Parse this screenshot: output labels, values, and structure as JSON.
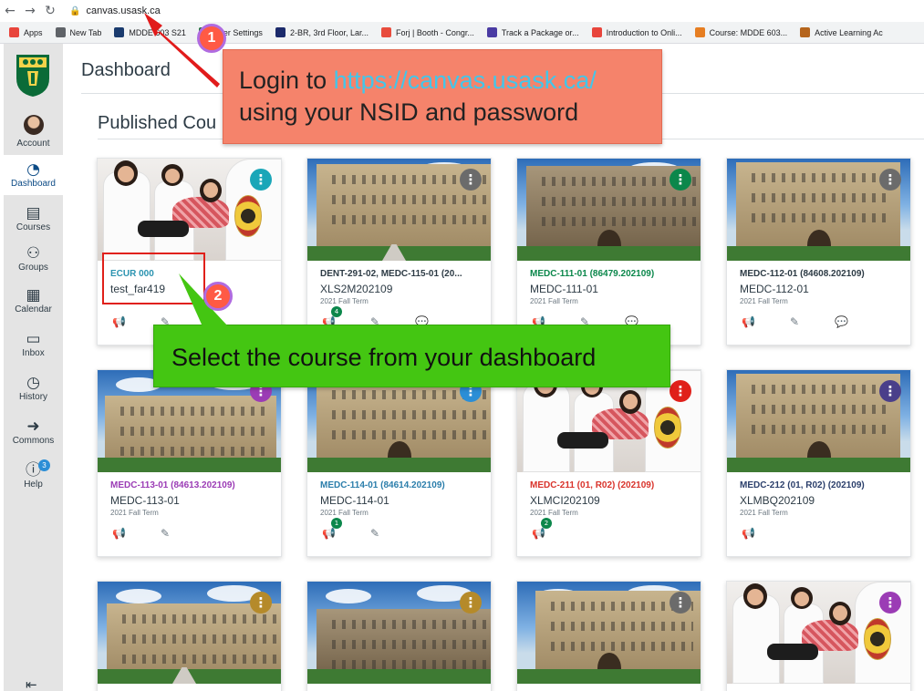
{
  "browser": {
    "url": "canvas.usask.ca",
    "bookmarks": [
      {
        "label": "Apps",
        "color": "#e8453c"
      },
      {
        "label": "New Tab",
        "color": "#5f6368"
      },
      {
        "label": "MDDE 603 S21",
        "color": "#1a3b6e"
      },
      {
        "label": "User Settings",
        "color": "#1f6f3b"
      },
      {
        "label": "2-BR, 3rd Floor, Lar...",
        "color": "#1b2a6b"
      },
      {
        "label": "Forj | Booth - Congr...",
        "color": "#e84c3d"
      },
      {
        "label": "Track a Package or...",
        "color": "#4a3ba3"
      },
      {
        "label": "Introduction to Onli...",
        "color": "#e8453c"
      },
      {
        "label": "Course: MDDE 603...",
        "color": "#e67e22"
      },
      {
        "label": "Active Learning Ac",
        "color": "#b5651d"
      }
    ]
  },
  "nav": {
    "account": "Account",
    "dashboard": "Dashboard",
    "courses": "Courses",
    "groups": "Groups",
    "calendar": "Calendar",
    "inbox": "Inbox",
    "history": "History",
    "commons": "Commons",
    "help": "Help",
    "help_badge": "3"
  },
  "page": {
    "title": "Dashboard",
    "section": "Published Cou"
  },
  "cards": [
    {
      "title": "ECUR 000",
      "sub": "test_far419",
      "term": "",
      "color": "#2a93b0",
      "kebab": "#1aa6b8"
    },
    {
      "title": "DENT-291-02, MEDC-115-01 (20...",
      "sub": "XLS2M202109",
      "term": "2021 Fall Term",
      "color": "#2d3b45",
      "kebab": "#6b6b6b",
      "badge": "4"
    },
    {
      "title": "MEDC-111-01 (86479.202109)",
      "sub": "MEDC-111-01",
      "term": "2021 Fall Term",
      "color": "#0b874b",
      "kebab": "#0b874b"
    },
    {
      "title": "MEDC-112-01 (84608.202109)",
      "sub": "MEDC-112-01",
      "term": "2021 Fall Term",
      "color": "#2d3b45",
      "kebab": "#6b6b6b"
    },
    {
      "title": "MEDC-113-01 (84613.202109)",
      "sub": "MEDC-113-01",
      "term": "2021 Fall Term",
      "color": "#9b3cb5",
      "kebab": "#9b3cb5"
    },
    {
      "title": "MEDC-114-01 (84614.202109)",
      "sub": "MEDC-114-01",
      "term": "2021 Fall Term",
      "color": "#2b7eab",
      "kebab": "#2b8ed6",
      "badge": "1"
    },
    {
      "title": "MEDC-211 (01, R02) (202109)",
      "sub": "XLMCI202109",
      "term": "2021 Fall Term",
      "color": "#d9332b",
      "kebab": "#e0201a",
      "badge": "2"
    },
    {
      "title": "MEDC-212 (01, R02) (202109)",
      "sub": "XLMBQ202109",
      "term": "2021 Fall Term",
      "color": "#2b3f6b",
      "kebab": "#4a3f8a"
    },
    {
      "kebab": "#b58a2a"
    },
    {
      "kebab": "#b58a2a"
    },
    {
      "kebab": "#6b6b6b"
    },
    {
      "kebab": "#9b3cb5"
    }
  ],
  "annotations": {
    "step1": "1",
    "step2": "2",
    "login_prefix": "Login to ",
    "login_link": "https://canvas.usask.ca/",
    "login_line2": "using your NSID and password",
    "select_text": "Select the course from your dashboard"
  }
}
